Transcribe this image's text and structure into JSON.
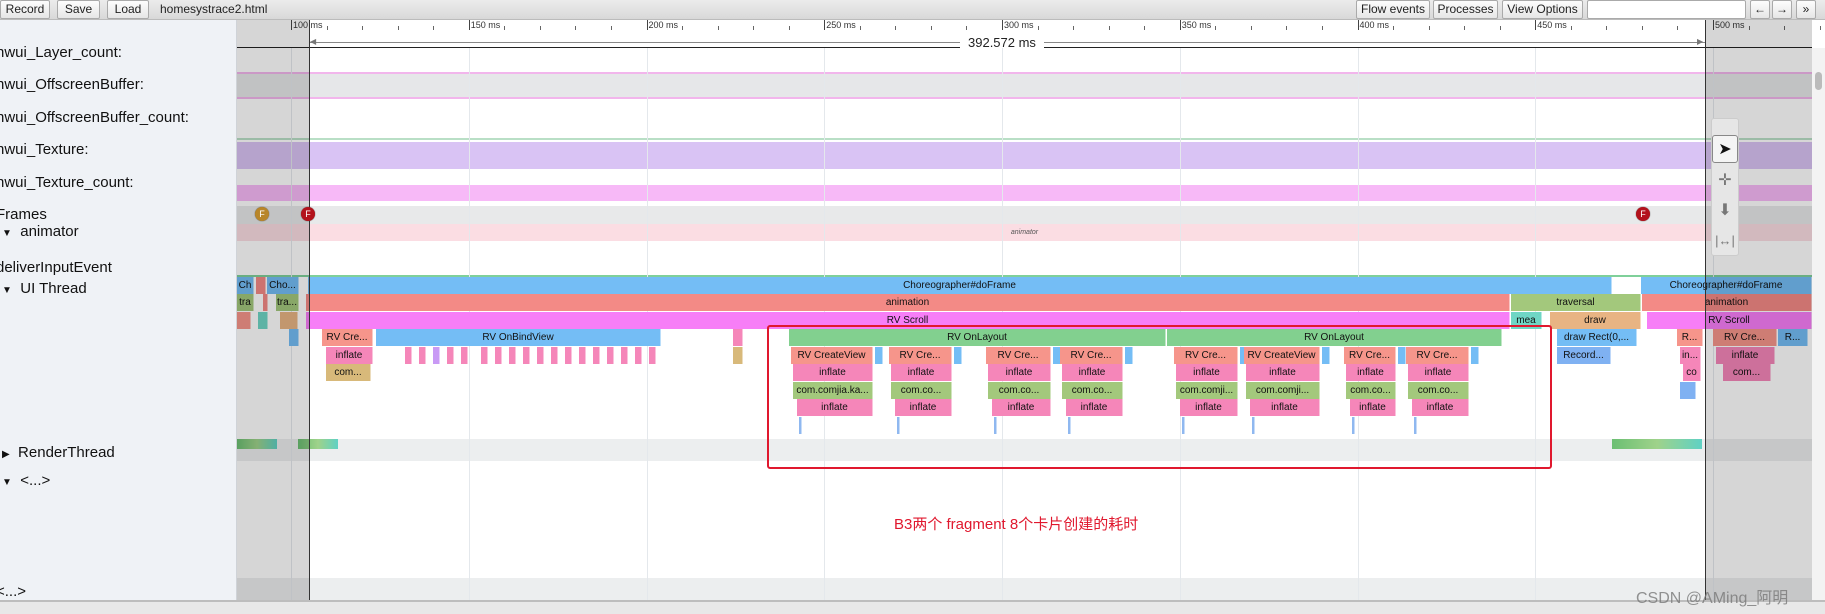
{
  "toolbar": {
    "record": "Record",
    "save": "Save",
    "load": "Load",
    "filename": "homesystrace2.html",
    "flow_events": "Flow events",
    "processes": "Processes",
    "view_options": "View Options",
    "nav_left": "←",
    "nav_right": "→",
    "more": "»"
  },
  "ruler": {
    "ticks": [
      "100 ms",
      "150 ms",
      "200 ms",
      "250 ms",
      "300 ms",
      "350 ms",
      "400 ms",
      "450 ms",
      "500 ms"
    ],
    "measurement": "392.572 ms"
  },
  "tracks": {
    "layer_count": "hwui_Layer_count:",
    "offscreen": "hwui_OffscreenBuffer:",
    "offscreen_count": "hwui_OffscreenBuffer_count:",
    "texture": "hwui_Texture:",
    "texture_count": "hwui_Texture_count:",
    "frames": "Frames",
    "animator": "animator",
    "animator_slice": "animator",
    "deliver": "deliverInputEvent",
    "ui_thread": "UI Thread",
    "render_thread": "RenderThread",
    "ellipsis1": "<...>",
    "ellipsis2": "<...>"
  },
  "frame_markers": [
    {
      "label": "F",
      "color": "#b8862a"
    },
    {
      "label": "F",
      "color": "#b3121c"
    },
    {
      "label": "F",
      "color": "#b3121c"
    }
  ],
  "colors": {
    "blue": "#74bdf5",
    "red": "#f38a86",
    "magenta": "#f77ef7",
    "green": "#82d08f",
    "salmon": "#f6958b",
    "pink": "#f586b9",
    "olive": "#a3c87c",
    "tan": "#d8b97a",
    "teal": "#6fd6c5",
    "draw": "#e8b483",
    "record": "#7fb1f2",
    "highlight": "#e0182e"
  },
  "slices": [
    {
      "label": "Ch",
      "color": "blue"
    },
    {
      "label": "Cho...",
      "color": "blue"
    },
    {
      "label": "Choreographer#doFrame",
      "color": "blue"
    },
    {
      "label": "Choreographer#doFrame",
      "color": "blue"
    },
    {
      "label": "tra",
      "color": "olive"
    },
    {
      "label": "tra...",
      "color": "olive"
    },
    {
      "label": "animation",
      "color": "red"
    },
    {
      "label": "traversal",
      "color": "olive"
    },
    {
      "label": "animation",
      "color": "red"
    },
    {
      "label": "RV Scroll",
      "color": "magenta"
    },
    {
      "label": "mea",
      "color": "teal"
    },
    {
      "label": "draw",
      "color": "draw"
    },
    {
      "label": "RV Scroll",
      "color": "magenta"
    },
    {
      "label": "RV Cre...",
      "color": "salmon"
    },
    {
      "label": "RV OnBindView",
      "color": "blue"
    },
    {
      "label": "RV OnLayout",
      "color": "green"
    },
    {
      "label": "RV OnLayout",
      "color": "green"
    },
    {
      "label": "draw Rect(0,...",
      "color": "blue"
    },
    {
      "label": "R...",
      "color": "salmon"
    },
    {
      "label": "RV Cre...",
      "color": "salmon"
    },
    {
      "label": "R...",
      "color": "blue"
    },
    {
      "label": "inflate",
      "color": "pink"
    },
    {
      "label": "Record...",
      "color": "record"
    },
    {
      "label": "in...",
      "color": "pink"
    },
    {
      "label": "inflate",
      "color": "pink"
    },
    {
      "label": "com...",
      "color": "tan"
    },
    {
      "label": "co",
      "color": "pink"
    },
    {
      "label": "com...",
      "color": "pink"
    }
  ],
  "cards": [
    {
      "create": "RV CreateView",
      "inflate": "inflate",
      "cls": "com.comjia.ka...",
      "inflate2": "inflate"
    },
    {
      "create": "RV Cre...",
      "inflate": "inflate",
      "cls": "com.co...",
      "inflate2": "inflate"
    },
    {
      "create": "RV Cre...",
      "inflate": "inflate",
      "cls": "com.co...",
      "inflate2": "inflate"
    },
    {
      "create": "RV Cre...",
      "inflate": "inflate",
      "cls": "com.co...",
      "inflate2": "inflate"
    },
    {
      "create": "RV Cre...",
      "inflate": "inflate",
      "cls": "com.comji...",
      "inflate2": "inflate"
    },
    {
      "create": "RV CreateView",
      "inflate": "inflate",
      "cls": "com.comji...",
      "inflate2": "inflate"
    },
    {
      "create": "RV Cre...",
      "inflate": "inflate",
      "cls": "com.co...",
      "inflate2": "inflate"
    },
    {
      "create": "RV Cre...",
      "inflate": "inflate",
      "cls": "com.co...",
      "inflate2": "inflate"
    }
  ],
  "annotation": "B3两个 fragment 8个卡片创建的耗时",
  "watermark": "CSDN @AMing_阿明"
}
